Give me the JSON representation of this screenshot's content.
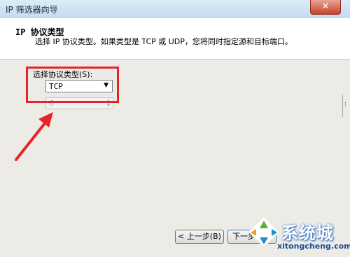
{
  "window": {
    "title": "IP 筛选器向导",
    "close_glyph": "✕"
  },
  "header": {
    "title": "IP 协议类型",
    "description": "选择 IP 协议类型。如果类型是 TCP 或 UDP，您将同时指定源和目标端口。"
  },
  "form": {
    "protocol_label": "选择协议类型(S):",
    "protocol_value": "TCP",
    "protocol_number": "6"
  },
  "buttons": {
    "back_label": "< 上一步(B)",
    "next_label": "下一步(N)"
  },
  "watermark": {
    "brand": "系统城",
    "url": "xitongcheng.com"
  },
  "colors": {
    "annotation_red": "#e8242a"
  }
}
